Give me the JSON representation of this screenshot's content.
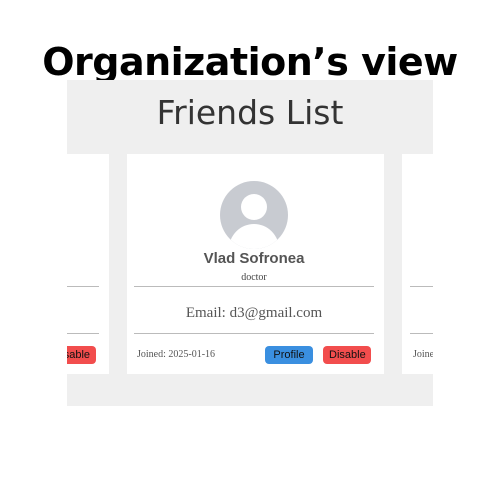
{
  "heading": "Organization’s view",
  "panel": {
    "title": "Friends List"
  },
  "cards": {
    "center": {
      "name": "Vlad Sofronea",
      "role": "doctor",
      "email": "Email: d3@gmail.com",
      "joined": "Joined: 2025-01-16",
      "profile_label": "Profile",
      "disable_label": "Disable"
    },
    "left": {
      "disable_label": "sable"
    },
    "right": {
      "joined": "Joine"
    }
  },
  "colors": {
    "panel_bg": "#efefef",
    "profile_button": "#3a8fe0",
    "disable_button": "#f24d4d",
    "avatar": "#c8cbd1"
  }
}
